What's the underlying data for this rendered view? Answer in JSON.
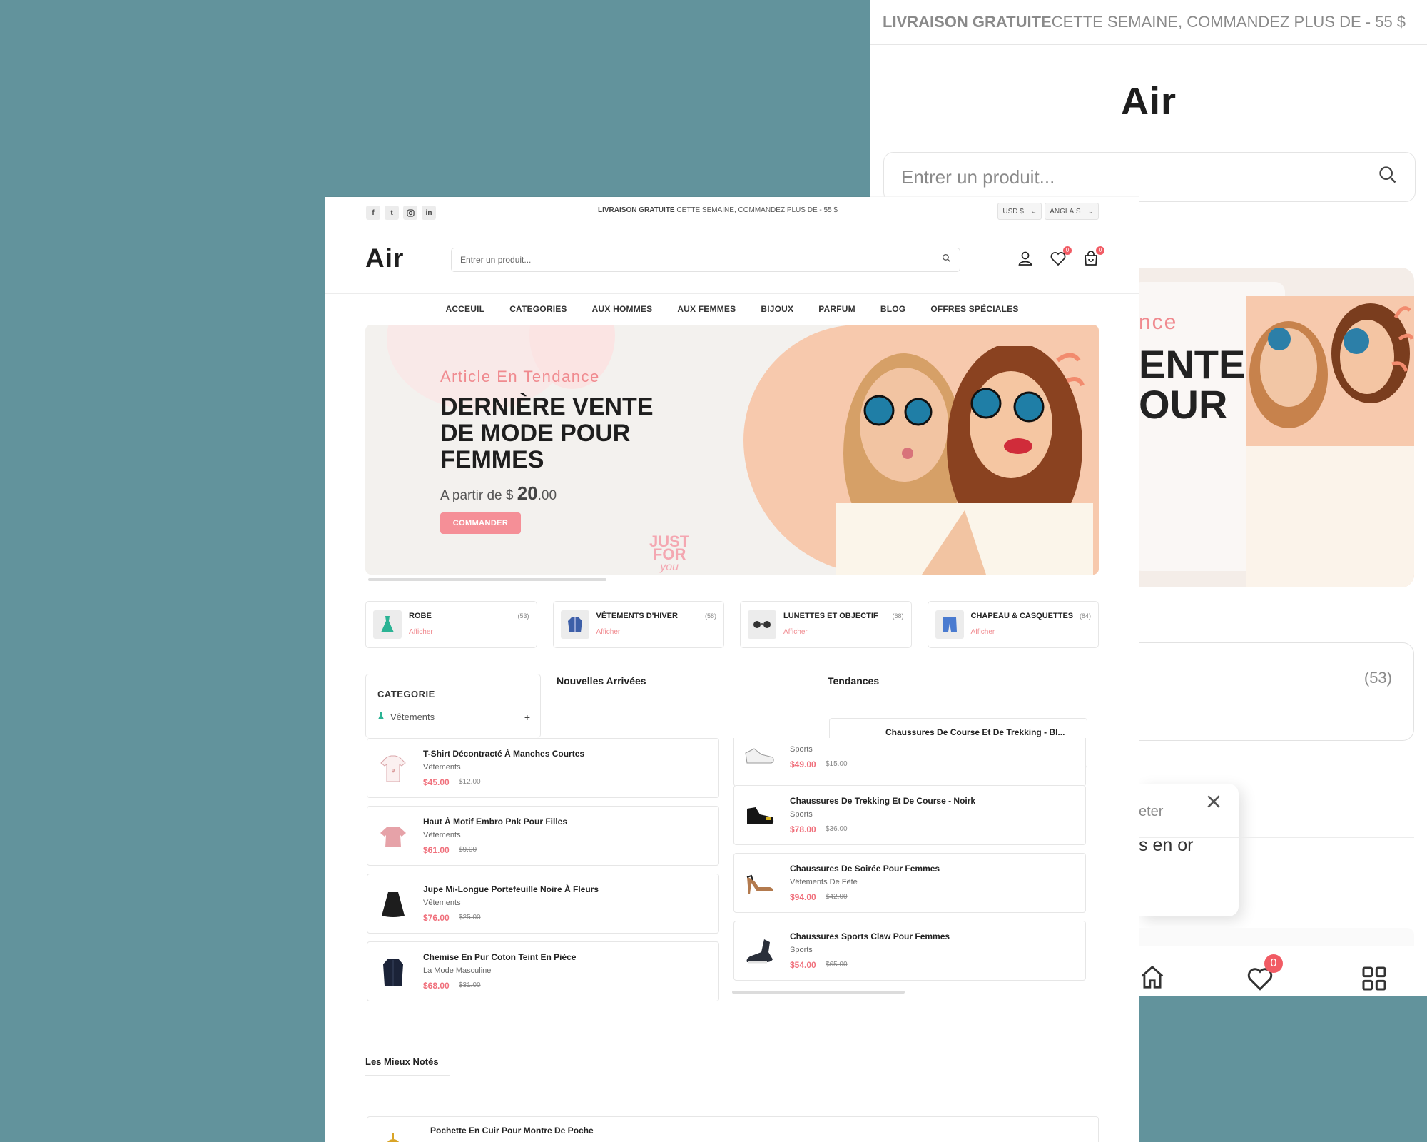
{
  "mobile": {
    "shipping_bold": "LIVRAISON GRATUITE",
    "shipping_rest": " CETTE SEMAINE, COMMANDEZ PLUS DE - 55 $",
    "logo": "Air",
    "search_placeholder": "Entrer un produit...",
    "banner_sub": "nce",
    "banner_title_1": "ENTE",
    "banner_title_2": "OUR",
    "category_count": "(53)",
    "popup_text_1": "eter",
    "popup_text_2": "s en or",
    "wishlist_badge": "0"
  },
  "desktop": {
    "topbar": {
      "socials": [
        "facebook",
        "twitter",
        "instagram",
        "linkedin"
      ],
      "shipping_bold": "LIVRAISON GRATUITE",
      "shipping_rest": " CETTE SEMAINE, COMMANDEZ PLUS DE - 55 $",
      "currency": "USD $",
      "language": "ANGLAIS"
    },
    "header": {
      "logo": "Air",
      "search_placeholder": "Entrer un produit...",
      "wishlist_badge": "0",
      "cart_badge": "0"
    },
    "nav": [
      "ACCEUIL",
      "CATEGORIES",
      "AUX HOMMES",
      "AUX FEMMES",
      "BIJOUX",
      "PARFUM",
      "BLOG",
      "OFFRES SPÉCIALES"
    ],
    "hero": {
      "subtitle": "Article En Tendance",
      "title": "DERNIÈRE VENTE DE MODE POUR FEMMES",
      "price_prefix": "A partir de $ ",
      "price_whole": "20",
      "price_cents": ".00",
      "cta": "COMMANDER",
      "badge_line1": "JUST",
      "badge_line2": "FOR",
      "badge_line3": "you"
    },
    "categories": [
      {
        "name": "ROBE",
        "count": "(53)",
        "link": "Afficher",
        "icon": "dress-icon"
      },
      {
        "name": "VÊTEMENTS D'HIVER",
        "count": "(58)",
        "link": "Afficher",
        "icon": "jacket-icon"
      },
      {
        "name": "LUNETTES ET OBJECTIF",
        "count": "(68)",
        "link": "Afficher",
        "icon": "glasses-icon"
      },
      {
        "name": "CHAPEAU & CASQUETTES",
        "count": "(84)",
        "link": "Afficher",
        "icon": "shorts-icon"
      }
    ],
    "sidebar": {
      "title": "CATEGORIE",
      "item": "Vêtements"
    },
    "sections": {
      "new": "Nouvelles Arrivées",
      "trending": "Tendances",
      "top": "Les Mieux Notés"
    },
    "new_arrivals": [
      {
        "name": "T-Shirt Décontracté À Manches Courtes",
        "category": "Vêtements",
        "price": "$45.00",
        "old": "$12.00"
      },
      {
        "name": "Haut À Motif Embro Pnk Pour Filles",
        "category": "Vêtements",
        "price": "$61.00",
        "old": "$9.00"
      },
      {
        "name": "Jupe Mi-Longue Portefeuille Noire À Fleurs",
        "category": "Vêtements",
        "price": "$76.00",
        "old": "$25.00"
      },
      {
        "name": "Chemise En Pur Coton Teint En Pièce",
        "category": "La Mode Masculine",
        "price": "$68.00",
        "old": "$31.00"
      }
    ],
    "trending_header": "Chaussures De Course Et De Trekking - Bl...",
    "trending": [
      {
        "name": "Chaussures De Course",
        "category": "Sports",
        "price": "$49.00",
        "old": "$15.00"
      },
      {
        "name": "Chaussures De Trekking Et De Course - Noirk",
        "category": "Sports",
        "price": "$78.00",
        "old": "$36.00"
      },
      {
        "name": "Chaussures De Soirée Pour Femmes",
        "category": "Vêtements De Fête",
        "price": "$94.00",
        "old": "$42.00"
      },
      {
        "name": "Chaussures Sports Claw Pour Femmes",
        "category": "Sports",
        "price": "$54.00",
        "old": "$65.00"
      }
    ],
    "top_rated": [
      {
        "name": "Pochette En Cuir Pour Montre De Poche"
      }
    ]
  }
}
